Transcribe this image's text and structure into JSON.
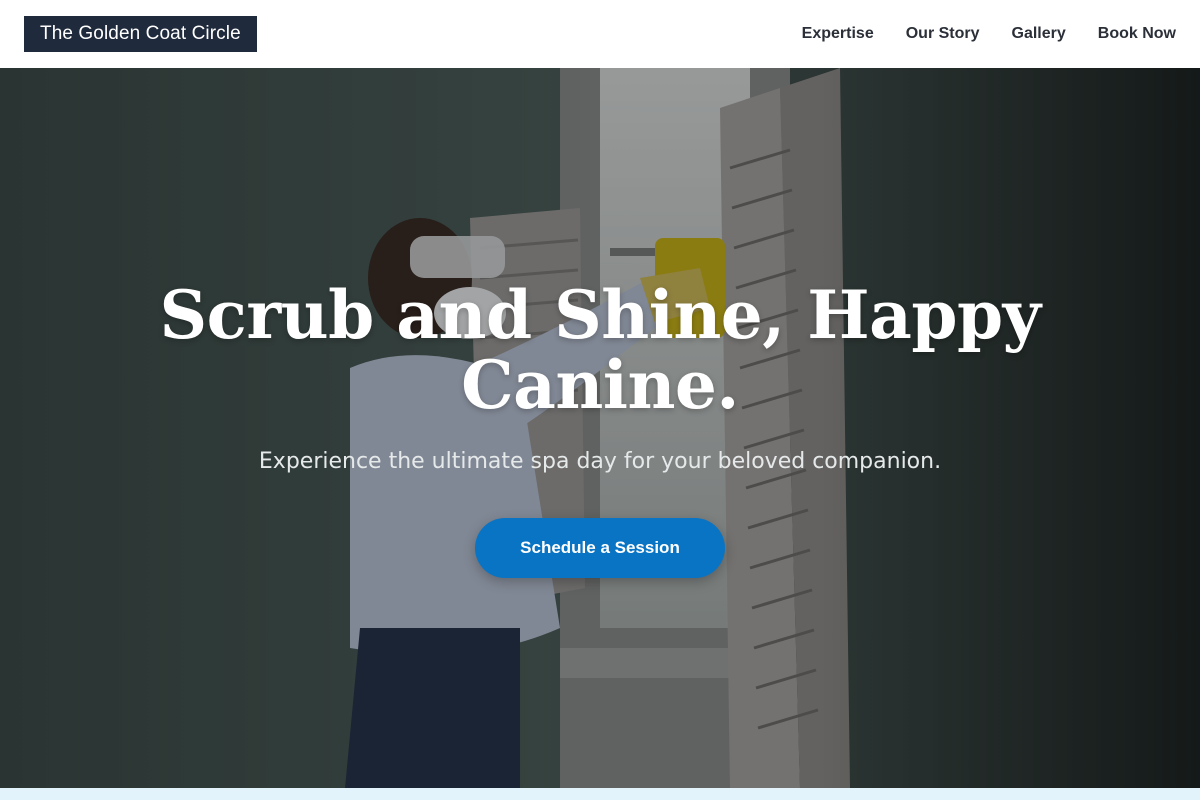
{
  "header": {
    "brand": "The Golden Coat Circle",
    "nav": [
      {
        "label": "Expertise"
      },
      {
        "label": "Our Story"
      },
      {
        "label": "Gallery"
      },
      {
        "label": "Book Now"
      }
    ]
  },
  "hero": {
    "title": "Scrub and Shine, Happy Canine.",
    "subtitle": "Experience the ultimate spa day for your beloved companion.",
    "cta_label": "Schedule a Session"
  },
  "colors": {
    "brand_bg": "#1f2a3c",
    "cta_bg": "#0a74c4",
    "footer_strip": "#e3f3fb"
  }
}
